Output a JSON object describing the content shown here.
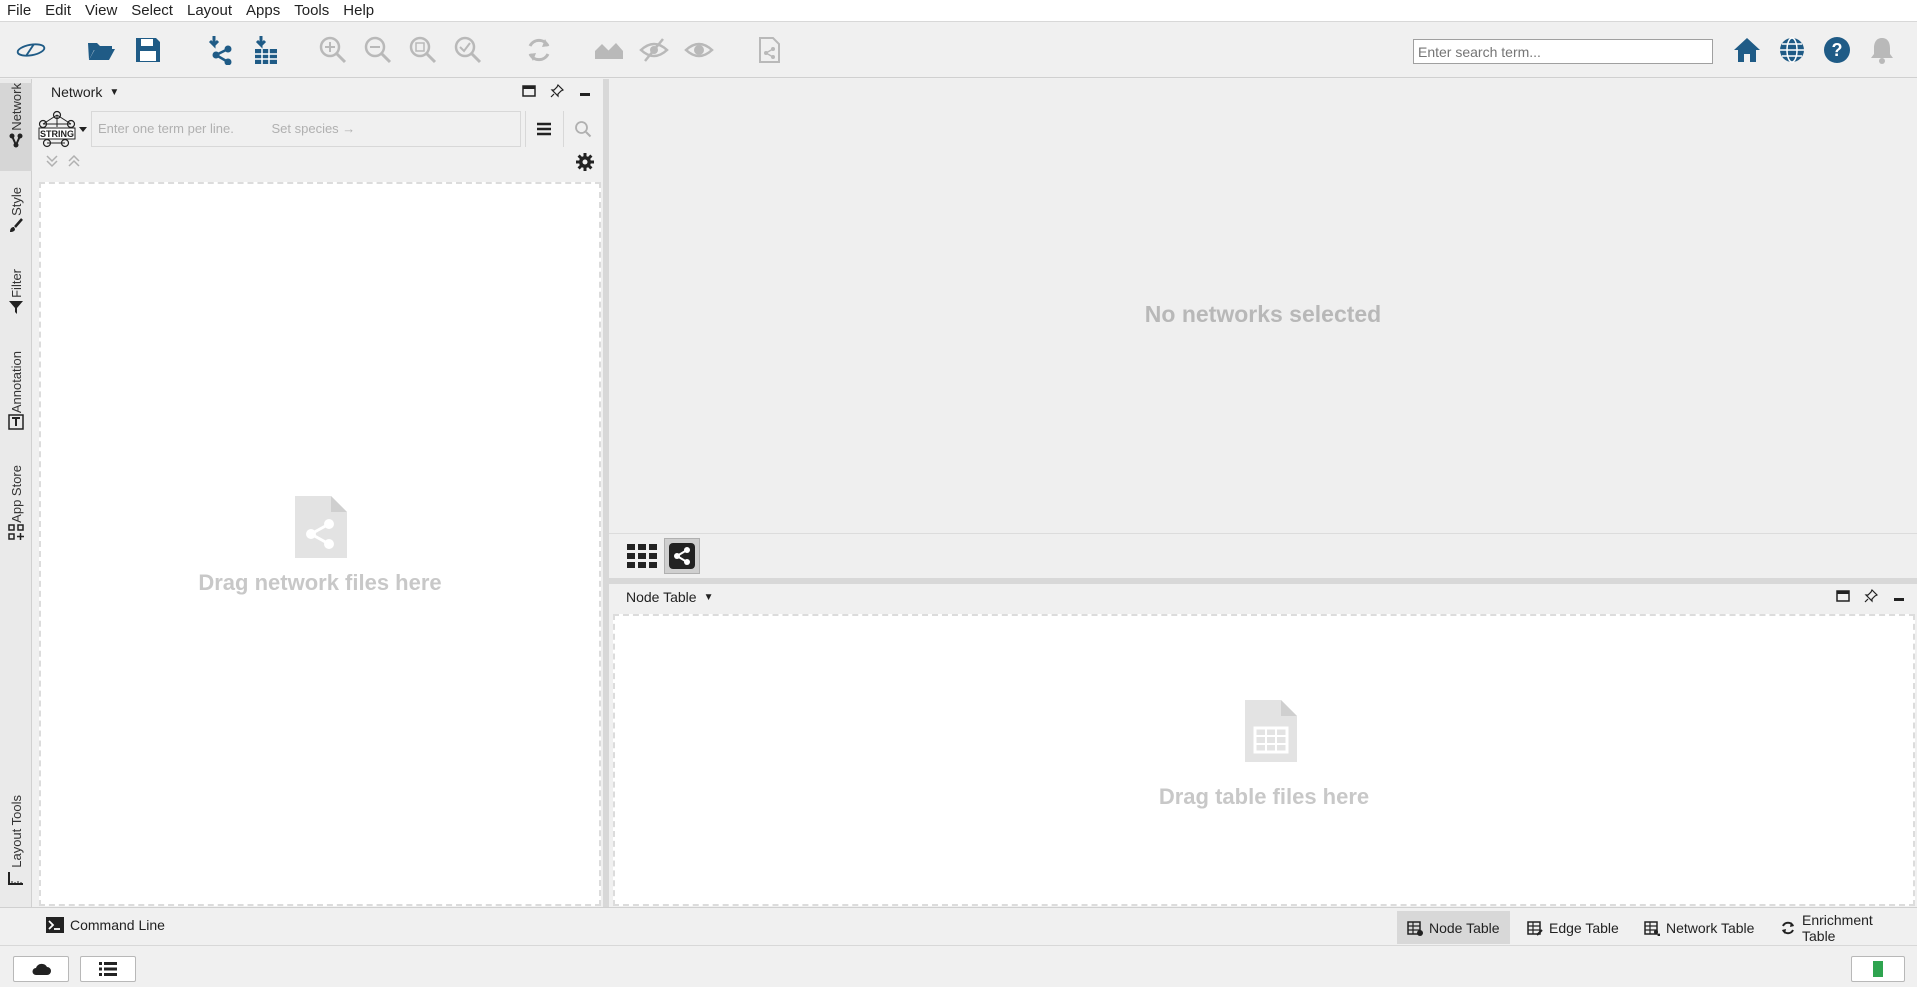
{
  "menubar": {
    "items": [
      "File",
      "Edit",
      "View",
      "Select",
      "Layout",
      "Apps",
      "Tools",
      "Help"
    ]
  },
  "toolbar": {
    "search_placeholder": "Enter search term..."
  },
  "left_tabs": [
    {
      "label": "Network",
      "icon": "share-icon",
      "active": true
    },
    {
      "label": "Style",
      "icon": "brush-icon"
    },
    {
      "label": "Filter",
      "icon": "filter-icon"
    },
    {
      "label": "Annotation",
      "icon": "text-annotation-icon"
    },
    {
      "label": "App Store",
      "icon": "app-grid-icon"
    },
    {
      "label": "Layout Tools",
      "icon": "ruler-icon"
    }
  ],
  "network_panel": {
    "title": "Network",
    "query_placeholder": "Enter one term per line.",
    "species_hint": "Set species →",
    "string_logo_text": "STRING",
    "drop_text": "Drag network files here"
  },
  "network_view": {
    "empty_message": "No networks selected"
  },
  "table_panel": {
    "title": "Node Table",
    "drop_text": "Drag table files here"
  },
  "bottom_tabs": {
    "command_line": "Command Line",
    "tabs": [
      {
        "label": "Node Table",
        "active": true
      },
      {
        "label": "Edge Table"
      },
      {
        "label": "Network Table"
      },
      {
        "label": "Enrichment Table"
      }
    ]
  },
  "colors": {
    "accent_blue": "#1f5b86",
    "icon_gray": "#b9b9b9",
    "status_green": "#2ea44f"
  }
}
